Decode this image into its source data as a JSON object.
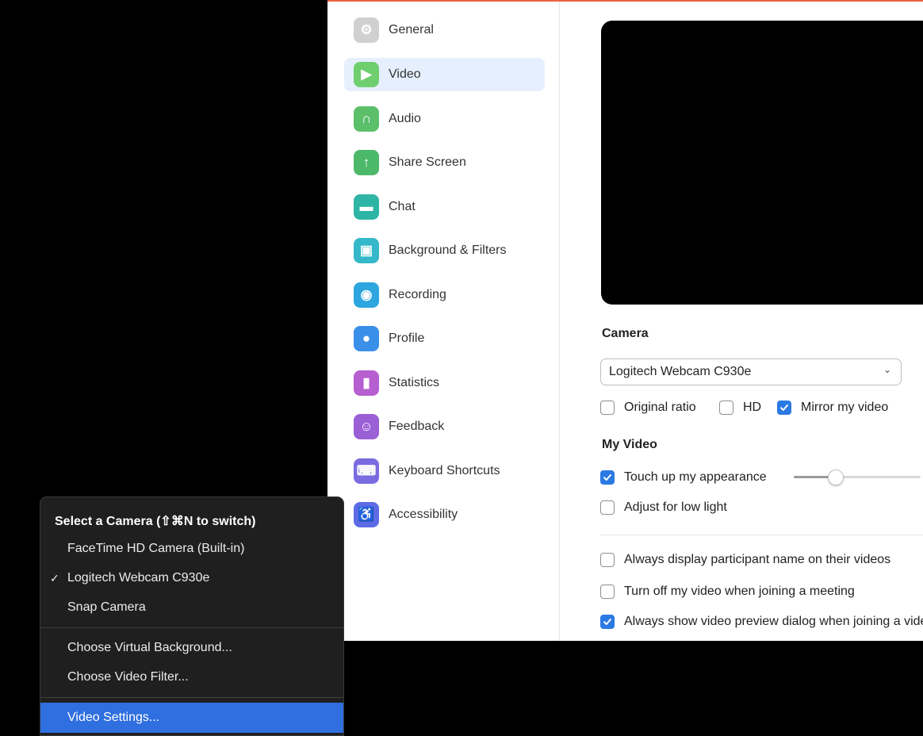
{
  "sidebar": {
    "items": [
      {
        "label": "General",
        "icon": "gear-icon",
        "color": "#d0d0d0",
        "glyph": "⚙"
      },
      {
        "label": "Video",
        "icon": "video-camera-icon",
        "color": "#6fcf6f",
        "glyph": "▶"
      },
      {
        "label": "Audio",
        "icon": "headphones-icon",
        "color": "#5cbf6a",
        "glyph": "∩"
      },
      {
        "label": "Share Screen",
        "icon": "share-screen-icon",
        "color": "#4cb86a",
        "glyph": "↑"
      },
      {
        "label": "Chat",
        "icon": "chat-bubble-icon",
        "color": "#2fb5a5",
        "glyph": "▬"
      },
      {
        "label": "Background & Filters",
        "icon": "background-icon",
        "color": "#35b8c9",
        "glyph": "▣"
      },
      {
        "label": "Recording",
        "icon": "record-icon",
        "color": "#2da6e0",
        "glyph": "◉"
      },
      {
        "label": "Profile",
        "icon": "profile-icon",
        "color": "#3a8fe8",
        "glyph": "●"
      },
      {
        "label": "Statistics",
        "icon": "statistics-icon",
        "color": "#b65fd1",
        "glyph": "▮"
      },
      {
        "label": "Feedback",
        "icon": "feedback-smile-icon",
        "color": "#9b5fd6",
        "glyph": "☺"
      },
      {
        "label": "Keyboard Shortcuts",
        "icon": "keyboard-icon",
        "color": "#7b6be0",
        "glyph": "⌨"
      },
      {
        "label": "Accessibility",
        "icon": "accessibility-icon",
        "color": "#5d6be6",
        "glyph": "♿"
      }
    ],
    "active_index": 1
  },
  "video": {
    "camera_title": "Camera",
    "camera_selected": "Logitech Webcam C930e",
    "original_ratio": {
      "label": "Original ratio",
      "checked": false
    },
    "hd": {
      "label": "HD",
      "checked": false
    },
    "mirror": {
      "label": "Mirror my video",
      "checked": true
    },
    "my_video_title": "My Video",
    "touch_up": {
      "label": "Touch up my appearance",
      "checked": true,
      "level": 0.33
    },
    "low_light": {
      "label": "Adjust for low light",
      "checked": false
    },
    "display_names": {
      "label": "Always display participant name on their videos",
      "checked": false
    },
    "turn_off": {
      "label": "Turn off my video when joining a meeting",
      "checked": false
    },
    "preview_dialog": {
      "label": "Always show video preview dialog when joining a video meeting",
      "checked": true
    }
  },
  "menu": {
    "header": "Select a Camera (⇧⌘N to switch)",
    "cameras": [
      {
        "label": "FaceTime HD Camera (Built-in)",
        "selected": false
      },
      {
        "label": "Logitech Webcam C930e",
        "selected": true
      },
      {
        "label": "Snap Camera",
        "selected": false
      }
    ],
    "check_mark": "✓",
    "virtual_background": "Choose Virtual Background...",
    "video_filter": "Choose Video Filter...",
    "video_settings": "Video Settings..."
  },
  "colors": {
    "accent": "#2b7ae4",
    "active_nav_bg": "#e5effd",
    "menu_highlight": "#2f6fe0",
    "window_top_border": "#e8643c"
  }
}
